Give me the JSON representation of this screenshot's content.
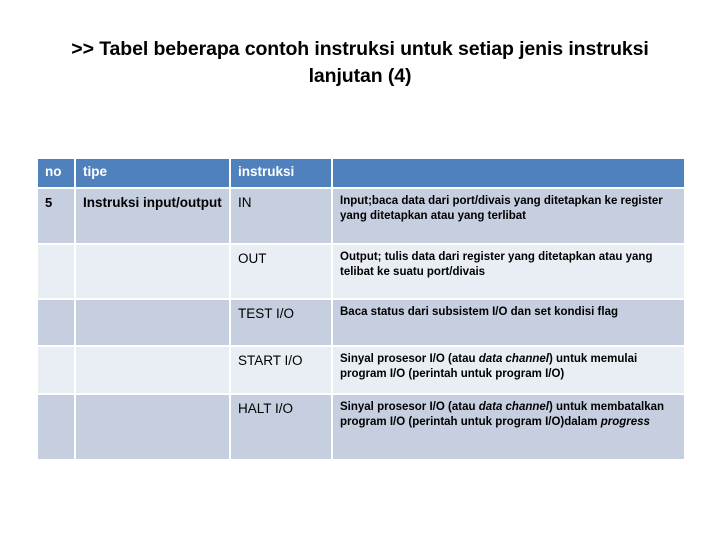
{
  "slide": {
    "title": ">> Tabel beberapa contoh instruksi untuk setiap jenis instruksi lanjutan (4)"
  },
  "table": {
    "headers": {
      "no": "no",
      "tipe": "tipe",
      "instruksi": "instruksi",
      "keterangan": ""
    },
    "rows": [
      {
        "no": "5",
        "tipe": "Instruksi input/output",
        "instruksi": "IN",
        "desc_parts": [
          {
            "text": "Input;baca data dari port/divais yang ditetapkan ke register yang ditetapkan atau yang terlibat",
            "italic": false
          }
        ]
      },
      {
        "no": "",
        "tipe": "",
        "instruksi": "OUT",
        "desc_parts": [
          {
            "text": "Output; tulis data dari register yang ditetapkan atau yang telibat ke suatu port/divais",
            "italic": false
          }
        ]
      },
      {
        "no": "",
        "tipe": "",
        "instruksi": "TEST I/O",
        "desc_parts": [
          {
            "text": "Baca status dari subsistem I/O dan set kondisi flag",
            "italic": false
          }
        ]
      },
      {
        "no": "",
        "tipe": "",
        "instruksi": "START I/O",
        "desc_parts": [
          {
            "text": "Sinyal prosesor I/O (atau ",
            "italic": false
          },
          {
            "text": "data channel",
            "italic": true
          },
          {
            "text": ") untuk memulai program I/O (perintah untuk program I/O)",
            "italic": false
          }
        ]
      },
      {
        "no": "",
        "tipe": "",
        "instruksi": "HALT I/O",
        "desc_parts": [
          {
            "text": "Sinyal prosesor I/O (atau ",
            "italic": false
          },
          {
            "text": "data channel",
            "italic": true
          },
          {
            "text": ") untuk membatalkan program I/O (perintah untuk program I/O)dalam ",
            "italic": false
          },
          {
            "text": "progress",
            "italic": true
          }
        ]
      }
    ]
  },
  "colors": {
    "header_fill": "#4f81bd",
    "row_dark": "#c6cfdf",
    "row_light": "#e9edf4",
    "page_background": "#ffffff",
    "text": "#000000",
    "header_text": "#ffffff"
  }
}
